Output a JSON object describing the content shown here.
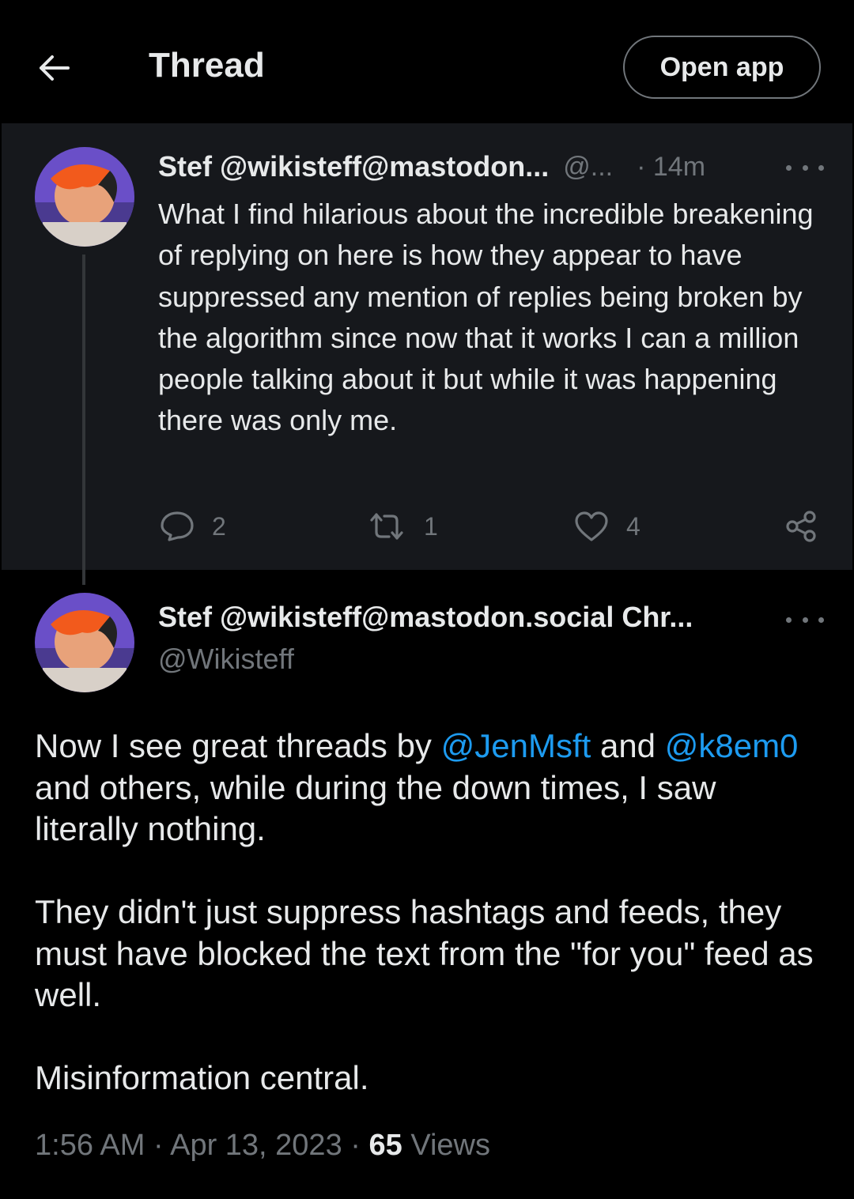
{
  "header": {
    "title": "Thread",
    "open_app_label": "Open app"
  },
  "parent_tweet": {
    "display_name": "Stef @wikisteff@mastodon...",
    "handle": "@...",
    "time": "· 14m",
    "text": "What I find hilarious about the incredible breakening of replying on here is how they appear to have suppressed any mention of replies being broken by the algorithm since now that it works I can a million people talking about it but while it was happening there was only me.",
    "replies": "2",
    "retweets": "1",
    "likes": "4"
  },
  "main_tweet": {
    "display_name": "Stef @wikisteff@mastodon.social Chr...",
    "handle": "@Wikisteff",
    "para1_before": "Now I see great threads by ",
    "mention1": "@JenMsft",
    "para1_mid": " and ",
    "mention2": "@k8em0",
    "para1_after": " and others, while during the down times, I saw literally nothing.",
    "para2": "They didn't just suppress hashtags and feeds, they must have blocked the text from the \"for you\" feed as well.",
    "para3": "Misinformation central.",
    "timestamp": "1:56 AM · Apr 13, 2023 · ",
    "views_count": "65",
    "views_label": " Views"
  },
  "colors": {
    "background": "#000000",
    "parent_background": "#16181c",
    "text": "#e7e9ea",
    "secondary": "#71767b",
    "link": "#1d9bf0"
  },
  "icons": [
    "back-arrow-icon",
    "more-icon",
    "reply-icon",
    "retweet-icon",
    "like-icon",
    "share-icon"
  ]
}
